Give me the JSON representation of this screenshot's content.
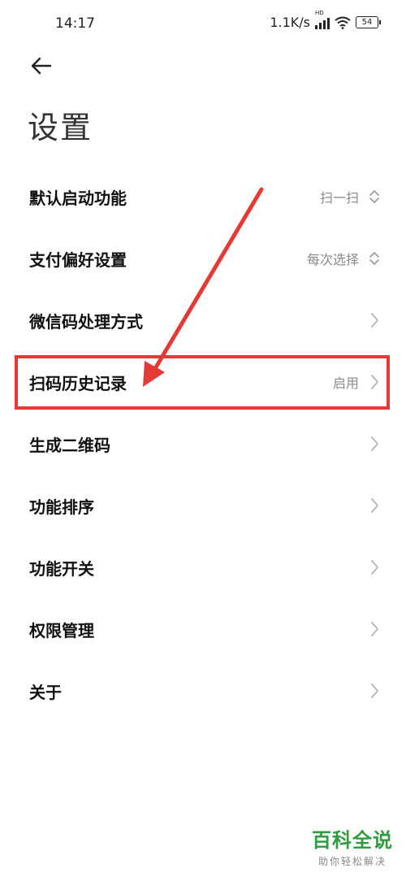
{
  "status_bar": {
    "time": "14:17",
    "net_speed": "1.1K/s",
    "signal_badge": "HD",
    "battery": "54"
  },
  "header": {
    "back_icon": "arrow-left-icon",
    "title": "设置"
  },
  "settings": [
    {
      "label": "默认启动功能",
      "value": "扫一扫",
      "control": "updown"
    },
    {
      "label": "支付偏好设置",
      "value": "每次选择",
      "control": "updown"
    },
    {
      "label": "微信码处理方式",
      "value": "",
      "control": "chevron"
    },
    {
      "label": "扫码历史记录",
      "value": "启用",
      "control": "chevron"
    },
    {
      "label": "生成二维码",
      "value": "",
      "control": "chevron"
    },
    {
      "label": "功能排序",
      "value": "",
      "control": "chevron"
    },
    {
      "label": "功能开关",
      "value": "",
      "control": "chevron"
    },
    {
      "label": "权限管理",
      "value": "",
      "control": "chevron"
    },
    {
      "label": "关于",
      "value": "",
      "control": "chevron"
    }
  ],
  "annotation": {
    "highlight_color": "#e53935"
  },
  "watermark": {
    "title": "百科全说",
    "subtitle": "助你轻松解决"
  }
}
